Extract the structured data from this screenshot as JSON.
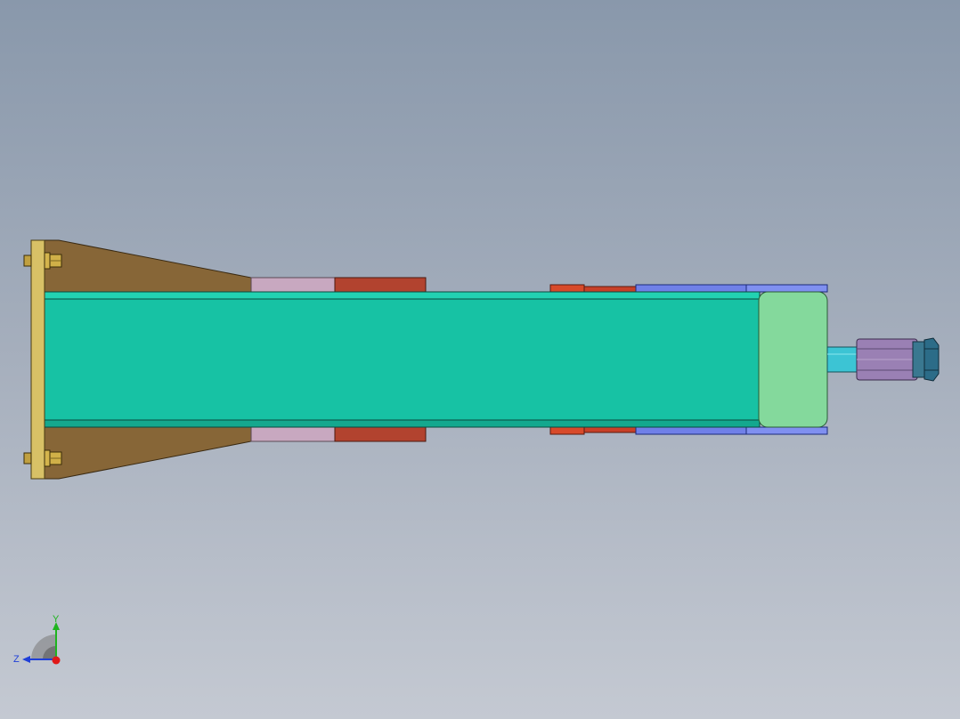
{
  "viewport": {
    "background_top": "#8998ab",
    "background_bottom": "#c4c9d2"
  },
  "model": {
    "tube_color": "#17c2a4",
    "end_cap_color": "#84d99c",
    "gusset_color": "#876637",
    "base_plate_color": "#d8c166",
    "bolt_color": "#c0a040",
    "clamp_pink_color": "#c8a8c0",
    "clamp_red_color": "#b2432f",
    "blue_plate_color": "#7080e8",
    "rod_color": "#3cc4d4",
    "cylinder_color": "#9a80b4",
    "nut_color": "#2c6c88"
  },
  "triad": {
    "y_label": "Y",
    "z_label": "Z",
    "y_color": "#1fb41f",
    "z_color": "#1f3fd8",
    "x_color": "#e01818"
  }
}
